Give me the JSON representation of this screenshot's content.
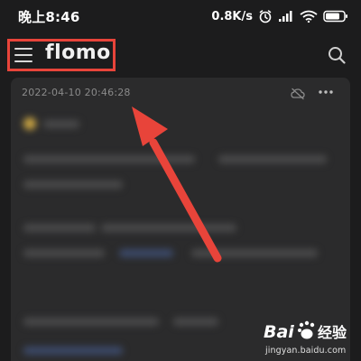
{
  "status_bar": {
    "time": "晚上8:46",
    "network_speed": "0.8K/s",
    "icons": [
      "alarm-icon",
      "signal-icon",
      "wifi-icon",
      "battery-icon"
    ]
  },
  "header": {
    "title": "flomo",
    "menu_icon": "hamburger-menu-icon",
    "search_icon": "search-icon"
  },
  "memo": {
    "timestamp": "2022-04-10 20:46:28",
    "sync_icon": "cloud-off-icon",
    "more_icon": "more-dots-icon"
  },
  "annotation": {
    "highlight_color": "#e8443a",
    "arrow_color": "#e8443a"
  },
  "watermark": {
    "logo_text": "Bai 经验",
    "url": "jingyan.baidu.com"
  },
  "colors": {
    "background": "#1c1c1d",
    "card": "#2b2b2c",
    "text_primary": "#f0f0f0",
    "text_secondary": "#8a8a8a"
  }
}
